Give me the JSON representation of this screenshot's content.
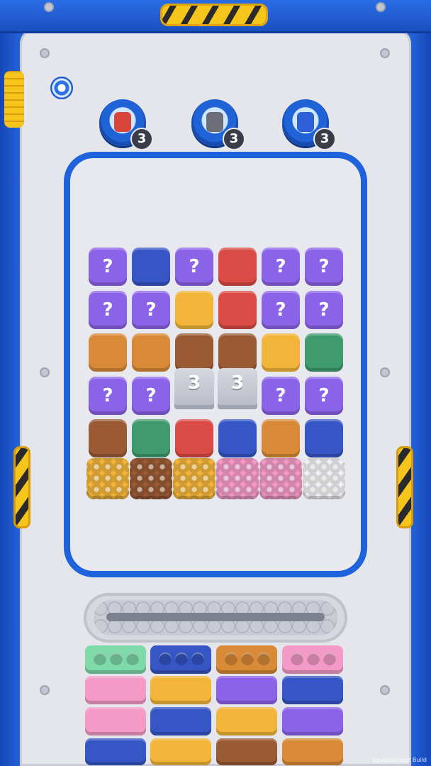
{
  "boosters": [
    {
      "name": "robot-booster",
      "count": "3",
      "color": "#d9443b"
    },
    {
      "name": "cannon-booster",
      "count": "3",
      "color": "#6b6e78"
    },
    {
      "name": "machine-booster",
      "count": "3",
      "color": "#2f5fd6"
    }
  ],
  "palette": {
    "purple": "#8b63e8",
    "blue": "#3556c4",
    "red": "#d94b44",
    "yellow": "#f2b53a",
    "orange": "#d98a36",
    "brown": "#9a5a34",
    "green": "#3f9a6e",
    "pink": "#f49ac6",
    "white": "#f2f2f4",
    "mint": "#7fdaaa",
    "frame_blue": "#1e63dc"
  },
  "grid": {
    "rows": [
      [
        "?",
        "blue",
        "?",
        "red",
        "?",
        "?"
      ],
      [
        "?",
        "?",
        "yellow",
        "red",
        "?",
        "?"
      ],
      [
        "orange",
        "orange",
        "brown",
        "brown",
        "yellow",
        "green"
      ],
      [
        "?",
        "?",
        "cup",
        "cup",
        "?",
        "?"
      ],
      [
        "brown",
        "green",
        "red",
        "blue",
        "orange",
        "blue"
      ]
    ],
    "cups": [
      "3",
      "3"
    ],
    "studded_row": [
      "yellow",
      "brown",
      "yellow",
      "pink",
      "pink",
      "white"
    ]
  },
  "trays": [
    {
      "color": "mint",
      "slots": 3
    },
    {
      "color": "blue",
      "slots": 3
    },
    {
      "color": "orange",
      "slots": 3
    },
    {
      "color": "pink",
      "slots": 3
    }
  ],
  "queue": [
    [
      "pink",
      "yellow",
      "purple",
      "blue"
    ],
    [
      "pink",
      "blue",
      "yellow",
      "purple"
    ],
    [
      "blue",
      "yellow",
      "brown",
      "orange"
    ]
  ],
  "footer": {
    "build_label": "Development Build"
  }
}
